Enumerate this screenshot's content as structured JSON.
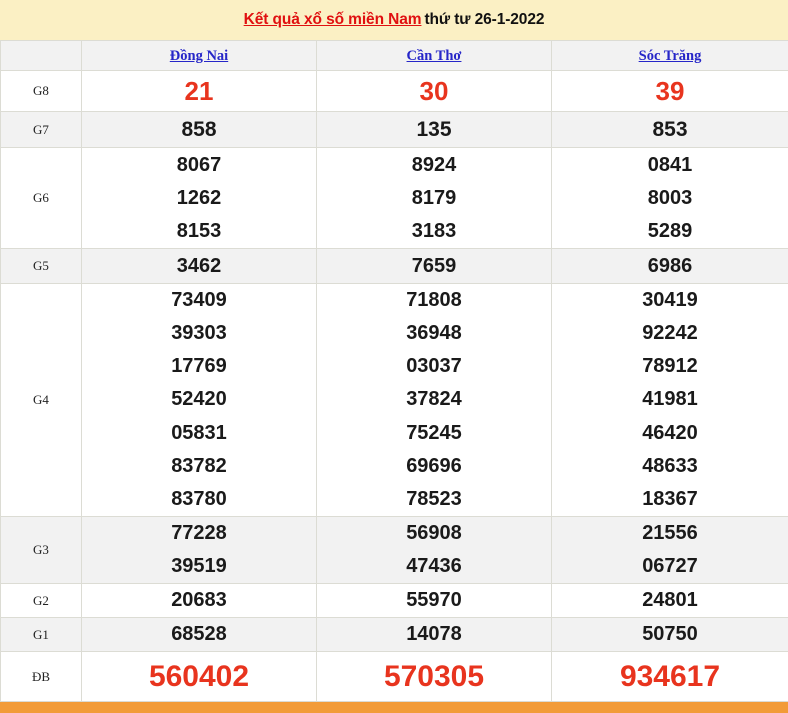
{
  "header": {
    "title_link": "Kết quả xổ số miền Nam",
    "title_rest": "thứ tư 26-1-2022",
    "background_color": "#fbf0c4",
    "link_color": "#e01010"
  },
  "table": {
    "corner_label": "",
    "provinces": [
      "Đồng Nai",
      "Cần Thơ",
      "Sóc Trăng"
    ],
    "province_link_color": "#2626c8",
    "prize_rows": [
      {
        "label": "G8",
        "shade": "white",
        "highlight": "red",
        "values": [
          [
            "21"
          ],
          [
            "30"
          ],
          [
            "39"
          ]
        ]
      },
      {
        "label": "G7",
        "shade": "gray",
        "highlight": "none",
        "values": [
          [
            "858"
          ],
          [
            "135"
          ],
          [
            "853"
          ]
        ]
      },
      {
        "label": "G6",
        "shade": "white",
        "highlight": "none",
        "values": [
          [
            "8067",
            "1262",
            "8153"
          ],
          [
            "8924",
            "8179",
            "3183"
          ],
          [
            "0841",
            "8003",
            "5289"
          ]
        ]
      },
      {
        "label": "G5",
        "shade": "gray",
        "highlight": "none",
        "values": [
          [
            "3462"
          ],
          [
            "7659"
          ],
          [
            "6986"
          ]
        ]
      },
      {
        "label": "G4",
        "shade": "white",
        "highlight": "none",
        "values": [
          [
            "73409",
            "39303",
            "17769",
            "52420",
            "05831",
            "83782",
            "83780"
          ],
          [
            "71808",
            "36948",
            "03037",
            "37824",
            "75245",
            "69696",
            "78523"
          ],
          [
            "30419",
            "92242",
            "78912",
            "41981",
            "46420",
            "48633",
            "18367"
          ]
        ]
      },
      {
        "label": "G3",
        "shade": "gray",
        "highlight": "none",
        "values": [
          [
            "77228",
            "39519"
          ],
          [
            "56908",
            "47436"
          ],
          [
            "21556",
            "06727"
          ]
        ]
      },
      {
        "label": "G2",
        "shade": "white",
        "highlight": "none",
        "values": [
          [
            "20683"
          ],
          [
            "55970"
          ],
          [
            "24801"
          ]
        ]
      },
      {
        "label": "G1",
        "shade": "gray",
        "highlight": "none",
        "values": [
          [
            "68528"
          ],
          [
            "14078"
          ],
          [
            "50750"
          ]
        ]
      },
      {
        "label": "ĐB",
        "shade": "white",
        "highlight": "red",
        "values": [
          [
            "560402"
          ],
          [
            "570305"
          ],
          [
            "934617"
          ]
        ]
      }
    ]
  },
  "footer": {
    "bar_color": "#f29b38"
  }
}
